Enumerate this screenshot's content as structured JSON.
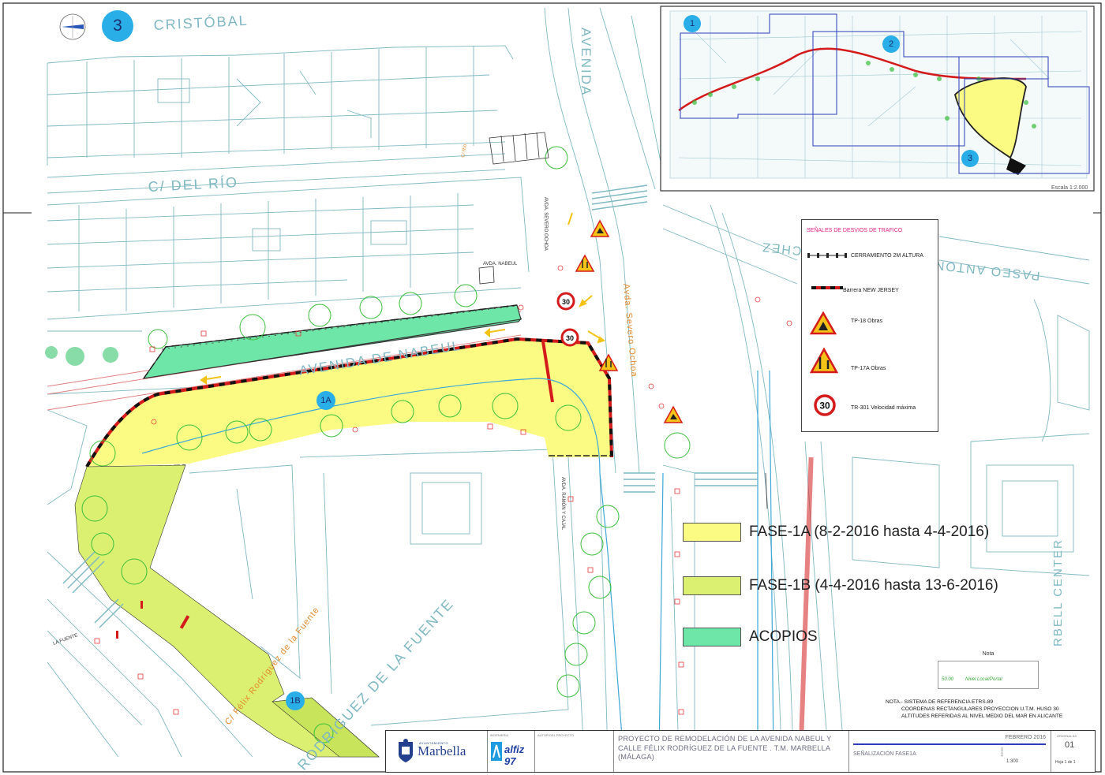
{
  "sheet_badge": "3",
  "streets": {
    "cristobal": "CRISTÓBAL",
    "del_rio": "C/ DEL RÍO",
    "avenida": "AVENIDA",
    "avenida_de_nabeul": "AVENIDA DE NABEUL",
    "paseo": "PASEO ANTONIO MONTERO SÁNCHEZ",
    "severo_ochoa": "Avda. Severo Ochoa",
    "severo_ochoa_small": "AVDA. SEVERO OCHOA",
    "nabeul_small": "AVDA. NABEUL",
    "ramon_cajal": "AVDA. RAMÓN Y CAJAL",
    "marbell_center": "RBELL CENTER",
    "felix_rodriguez": "RODRIGUEZ DE LA FUENTE",
    "felix_rodriguez_orange": "C/ Félix Rodríguez de la Fuente",
    "la_fuente": "LA FUENTE",
    "c_rio": "C/ Río"
  },
  "phase_markers": {
    "a": "1A",
    "b": "1B"
  },
  "inset": {
    "markers": [
      "1",
      "2",
      "3"
    ],
    "scale": "Escala 1:2.000"
  },
  "legend": {
    "title": "SEÑALES DE DESVIOS DE TRAFICO",
    "items": [
      {
        "label": "CERRAMIENTO  2M ALTURA",
        "icon": "fence-icon"
      },
      {
        "label": "Barrera NEW JERSEY",
        "icon": "barrier-icon"
      },
      {
        "label": "TP-18 Obras",
        "icon": "roadworks-sign-icon"
      },
      {
        "label": "TP-17A Obras",
        "icon": "narrowing-sign-icon"
      },
      {
        "label": "TR-301 Velocidad máxima",
        "icon": "speed-limit-icon"
      }
    ],
    "speed_value": "30"
  },
  "phases": [
    {
      "label": "FASE-1A (8-2-2016 hasta 4-4-2016)",
      "color": "#fbfa82"
    },
    {
      "label": "FASE-1B (4-4-2016 hasta 13-6-2016)",
      "color": "#dbef70"
    },
    {
      "label": "ACOPIOS",
      "color": "#6ee6a8"
    }
  ],
  "nota": {
    "title": "Nota",
    "value": "50.00",
    "label": "Nivel Local/Portal",
    "lines": [
      "NOTA.- SISTEMA DE REFERENCIA ETRS-89",
      "COORDENAS RECTANGULARES PROYECCION U.T.M. HUSO 30",
      "ALTITUDES REFERIDAS AL NIVEL MEDIO DEL MAR EN ALICANTE"
    ]
  },
  "title_block": {
    "ayuntamiento": "AYUNTAMIENTO",
    "city": "Marbella",
    "company": "alfiz 97",
    "ingenieria_label": "INGENIERIA",
    "autor_label": "AUTOR DEL PROYECTO",
    "project_title": "PROYECTO DE REMODELACIÓN DE LA AVENIDA NABEUL Y CALLE FÉLIX RODRÍGUEZ DE LA FUENTE . T.M. MARBELLA (MÁLAGA)",
    "date": "FEBRERO 2016",
    "sheet_title": "SEÑALIZACIÓN FASE1A",
    "escala_label": "Escala",
    "scale": "1:300",
    "plan_label": "ORIGINAL A3",
    "plan_number": "01",
    "sheets": "Hoja 1 de 1"
  },
  "colors": {
    "phase_1a": "#fbfa82",
    "phase_1b": "#dbef70",
    "acopios": "#6ee6a8",
    "cad_lines": "#7fb8c2",
    "orange_text": "#e38a2c",
    "badge": "#29aee8"
  }
}
